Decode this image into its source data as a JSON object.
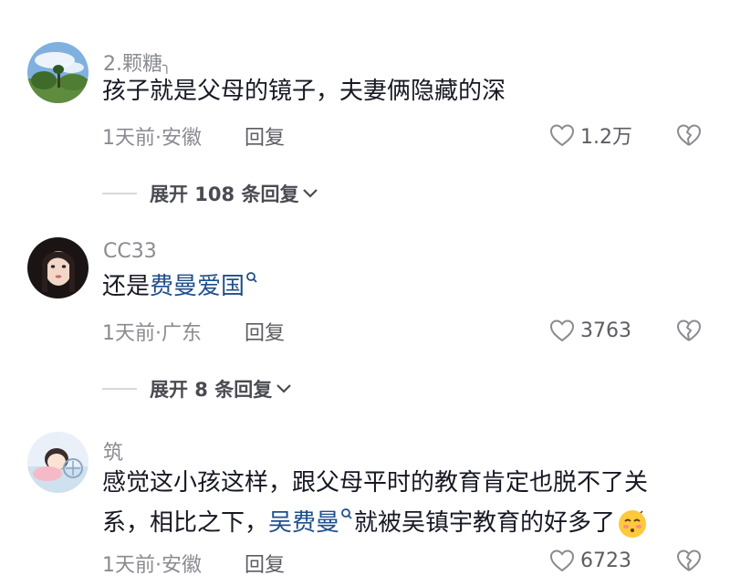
{
  "comments": [
    {
      "username": "2.颗糖",
      "username_suffix": "╮",
      "text": "孩子就是父母的镜子，夫妻俩隐藏的深",
      "time_location": "1天前·安徽",
      "reply_label": "回复",
      "likes": "1.2万",
      "expand_label": "展开 108 条回复"
    },
    {
      "username": "CC33",
      "text_prefix": "还是",
      "text_link": "费曼爱国",
      "time_location": "1天前·广东",
      "reply_label": "回复",
      "likes": "3763",
      "expand_label": "展开 8 条回复"
    },
    {
      "username": "筑",
      "text_line1": "感觉这小孩这样，跟父母平时的教育肯定也脱不了关",
      "text_line2_prefix": "系，相比之下，",
      "text_link": "吴费曼",
      "text_line2_suffix": "就被吴镇宇教育的好多了",
      "time_location": "1天前·安徽",
      "reply_label": "回复",
      "likes": "6723"
    }
  ],
  "colors": {
    "text": "#161823",
    "secondary": "#8a8b91",
    "link": "#1f4e8c"
  }
}
